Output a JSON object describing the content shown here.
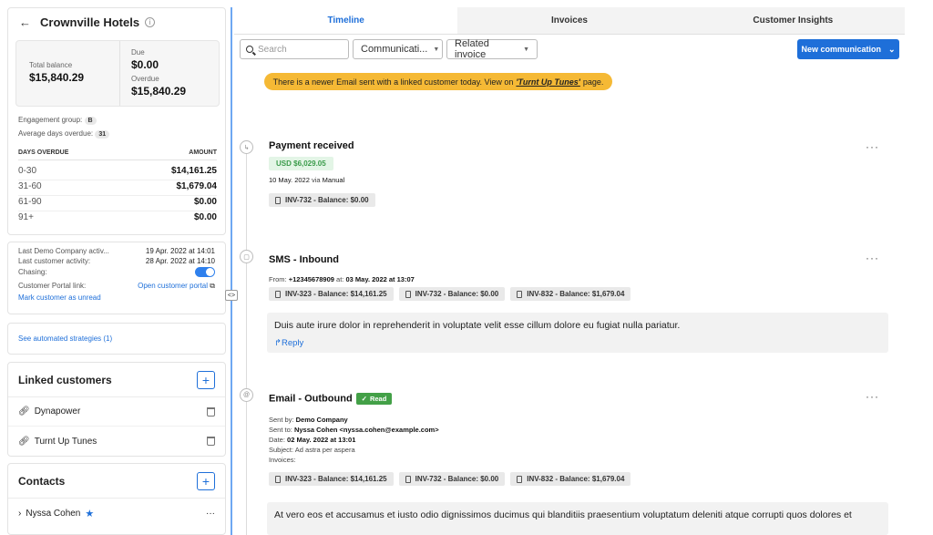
{
  "customer": {
    "name": "Crownville Hotels",
    "back_icon": "arrow-left-icon",
    "info_icon": "info-icon"
  },
  "balance": {
    "total_label": "Total balance",
    "total_value": "$15,840.29",
    "due_label": "Due",
    "due_value": "$0.00",
    "overdue_label": "Overdue",
    "overdue_value": "$15,840.29"
  },
  "engagement": {
    "group_label": "Engagement group:",
    "group_value": "B",
    "avg_days_label": "Average days overdue:",
    "avg_days_value": "31"
  },
  "aging": {
    "col_days": "DAYS OVERDUE",
    "col_amount": "AMOUNT",
    "rows": [
      {
        "range": "0-30",
        "amount": "$14,161.25"
      },
      {
        "range": "31-60",
        "amount": "$1,679.04"
      },
      {
        "range": "61-90",
        "amount": "$0.00"
      },
      {
        "range": "91+",
        "amount": "$0.00"
      }
    ]
  },
  "activity": {
    "last_company_label": "Last Demo Company activ...",
    "last_company_value": "19 Apr. 2022 at 14:01",
    "last_customer_label": "Last customer activity:",
    "last_customer_value": "28 Apr. 2022 at 14:10",
    "chasing_label": "Chasing:",
    "chasing_on": true,
    "portal_label": "Customer Portal link:",
    "portal_link": "Open customer portal",
    "mark_unread": "Mark customer as unread"
  },
  "strategies_link": "See automated strategies (1)",
  "linked_customers": {
    "title": "Linked customers",
    "items": [
      "Dynapower",
      "Turnt Up Tunes"
    ]
  },
  "contacts": {
    "title": "Contacts",
    "items": [
      "Nyssa Cohen"
    ]
  },
  "tabs": [
    "Timeline",
    "Invoices",
    "Customer Insights"
  ],
  "filters": {
    "search_placeholder": "Search",
    "communication": "Communicati...",
    "related_invoice": "Related invoice",
    "new_button": "New communication"
  },
  "notice": {
    "before": "There is a newer Email sent with a linked customer today. View on",
    "link": "'Turnt Up Tunes'",
    "after": "page."
  },
  "events": {
    "payment": {
      "title": "Payment received",
      "amount": "USD $6,029.05",
      "date": "10 May. 2022",
      "via_label": "via",
      "via_value": "Manual",
      "chips": [
        "INV-732 - Balance: $0.00"
      ]
    },
    "sms": {
      "title": "SMS - Inbound",
      "from_label": "From:",
      "from_value": "+12345678909",
      "at_label": "at:",
      "at_value": "03 May. 2022 at 13:07",
      "chips": [
        "INV-323 - Balance: $14,161.25",
        "INV-732 - Balance: $0.00",
        "INV-832 - Balance: $1,679.04"
      ],
      "body": "Duis aute irure dolor in reprehenderit in voluptate velit esse cillum dolore eu fugiat nulla pariatur.",
      "reply": "Reply"
    },
    "email": {
      "title": "Email - Outbound",
      "badge": "Read",
      "sent_by_label": "Sent by:",
      "sent_by_value": "Demo Company",
      "sent_to_label": "Sent to:",
      "sent_to_value": "Nyssa Cohen <nyssa.cohen@example.com>",
      "date_label": "Date:",
      "date_value": "02 May. 2022 at 13:01",
      "subject_label": "Subject:",
      "subject_value": "Ad astra per aspera",
      "invoices_label": "Invoices:",
      "chips": [
        "INV-323 - Balance: $14,161.25",
        "INV-732 - Balance: $0.00",
        "INV-832 - Balance: $1,679.04"
      ],
      "body": "At vero eos et accusamus et iusto odio dignissimos ducimus qui blanditiis praesentium voluptatum deleniti atque corrupti quos dolores et"
    }
  },
  "colors": {
    "accent": "#1e6fd9",
    "notice": "#f5b935",
    "success": "#43a047"
  }
}
